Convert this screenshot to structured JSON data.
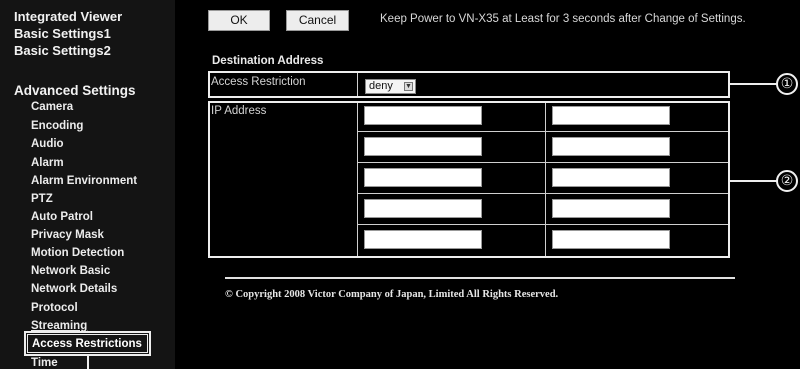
{
  "sidebar": {
    "top_items": [
      "Integrated Viewer",
      "Basic Settings1",
      "Basic Settings2"
    ],
    "advanced_heading": "Advanced Settings",
    "advanced_items": [
      "Camera",
      "Encoding",
      "Audio",
      "Alarm",
      "Alarm Environment",
      "PTZ",
      "Auto Patrol",
      "Privacy Mask",
      "Motion Detection",
      "Network Basic",
      "Network Details",
      "Protocol",
      "Streaming",
      "Access Restrictions",
      "Time"
    ],
    "selected_item": "Access Restrictions"
  },
  "toolbar": {
    "ok_label": "OK",
    "cancel_label": "Cancel",
    "notice": "Keep Power to VN-X35 at Least for 3 seconds after Change of Settings."
  },
  "section_title": "Destination Address",
  "access_restriction": {
    "label": "Access Restriction",
    "value": "deny"
  },
  "ip_address": {
    "label": "IP Address",
    "fields": [
      "",
      "",
      "",
      "",
      "",
      "",
      "",
      "",
      "",
      ""
    ]
  },
  "callouts": [
    "①",
    "②"
  ],
  "footer": {
    "copyright": "© Copyright 2008 Victor Company of Japan, Limited All Rights Reserved."
  }
}
